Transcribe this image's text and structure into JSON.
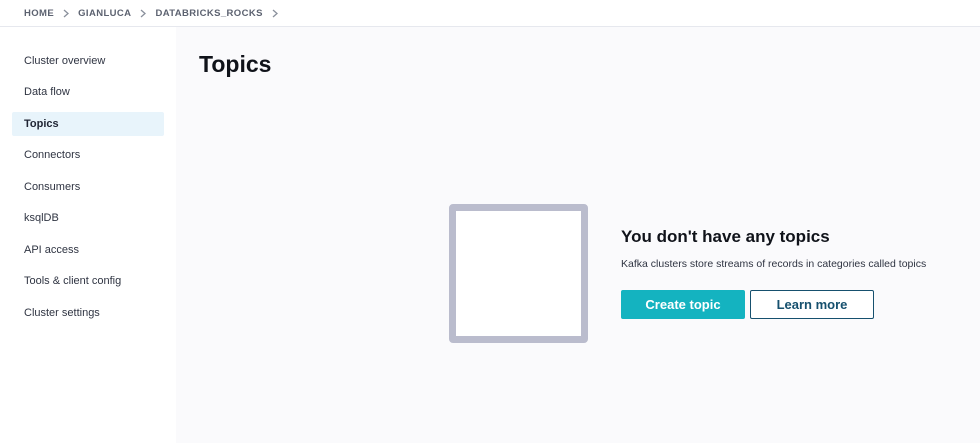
{
  "breadcrumb": {
    "items": [
      "HOME",
      "GIANLUCA",
      "DATABRICKS_ROCKS"
    ],
    "separator_icon": "chevron-right-icon"
  },
  "sidebar": {
    "items": [
      {
        "label": "Cluster overview",
        "active": false
      },
      {
        "label": "Data flow",
        "active": false
      },
      {
        "label": "Topics",
        "active": true
      },
      {
        "label": "Connectors",
        "active": false
      },
      {
        "label": "Consumers",
        "active": false
      },
      {
        "label": "ksqlDB",
        "active": false
      },
      {
        "label": "API access",
        "active": false
      },
      {
        "label": "Tools & client config",
        "active": false
      },
      {
        "label": "Cluster settings",
        "active": false
      }
    ]
  },
  "main": {
    "title": "Topics",
    "empty_state": {
      "heading": "You don't have any topics",
      "description": "Kafka clusters store streams of records in categories called topics",
      "primary_button": "Create topic",
      "secondary_button": "Learn more"
    }
  },
  "colors": {
    "accent": "#14b3c0",
    "active_nav_bg": "#e8f4fb",
    "secondary_button": "#16506e",
    "illustration_border": "#babccd"
  }
}
